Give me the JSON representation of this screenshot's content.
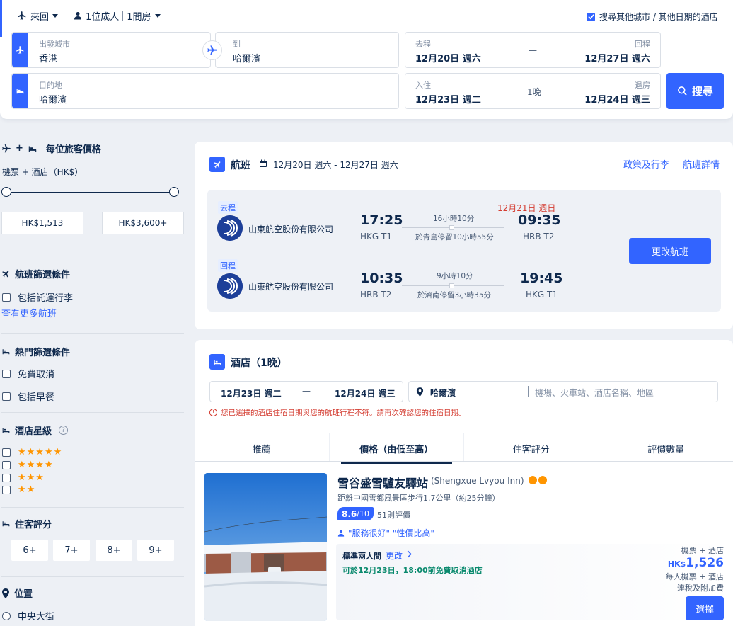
{
  "search": {
    "trip_type": "來回",
    "travellers": "1位成人",
    "rooms": "1間房",
    "other_city_option": "搜尋其他城市 / 其他日期的酒店",
    "from_label": "出發城市",
    "from_value": "香港",
    "to_label": "到",
    "to_value": "哈爾濱",
    "depart_label": "去程",
    "depart_value": "12月20日 週六",
    "return_label": "回程",
    "return_value": "12月27日 週六",
    "date_dash": "—",
    "dest_label": "目的地",
    "dest_value": "哈爾濱",
    "checkin_label": "入住",
    "checkin_value": "12月23日 週二",
    "nights": "1晚",
    "checkout_label": "退房",
    "checkout_value": "12月24日 週三",
    "search_button": "搜尋"
  },
  "sidebar": {
    "price_title": "每位旅客價格",
    "price_subtitle": "機票 + 酒店（HK$）",
    "plus": "+",
    "price_min": "HK$1,513",
    "price_dash": "-",
    "price_max": "HK$3,600+",
    "flight_filter_title": "航班篩選條件",
    "flight_filter_option": "包括託運行李",
    "more_flights_link": "查看更多航班",
    "popular_title": "熱門篩選條件",
    "popular_options": [
      "免費取消",
      "包括早餐"
    ],
    "star_title": "酒店星級",
    "star_levels": [
      "★★★★★",
      "★★★★",
      "★★★",
      "★★"
    ],
    "review_title": "住客評分",
    "review_options": [
      "6+",
      "7+",
      "8+",
      "9+"
    ],
    "location_title": "位置",
    "location_option": "中央大街"
  },
  "flight": {
    "title": "航班",
    "dates": "12月20日 週六 - 12月27日 週六",
    "policy_link": "政策及行李",
    "details_link": "航班詳情",
    "change_button": "更改航班",
    "outbound": {
      "tag": "去程",
      "airline": "山東航空股份有限公司",
      "dep_time": "17:25",
      "dep_airport": "HKG T1",
      "duration": "16小時10分",
      "stopover": "於青島停留10小時55分",
      "arrival_date": "12月21日 週日",
      "arr_time": "09:35",
      "arr_airport": "HRB T2"
    },
    "inbound": {
      "tag": "回程",
      "airline": "山東航空股份有限公司",
      "dep_time": "10:35",
      "dep_airport": "HRB T2",
      "duration": "9小時10分",
      "stopover": "於濟南停留3小時35分",
      "arr_time": "19:45",
      "arr_airport": "HKG T1"
    }
  },
  "hotel": {
    "title": "酒店（1晚）",
    "checkin": "12月23日 週二",
    "dash": "—",
    "checkout": "12月24日 週三",
    "city": "哈爾濱",
    "search_placeholder": "機場、火車站、酒店名稱、地區",
    "warning": "您已選擇的酒店住宿日期與您的航班行程不符。請再次確認您的住宿日期。",
    "tabs": [
      "推薦",
      "價格（由低至高）",
      "住客評分",
      "評價數量"
    ],
    "listing": {
      "name": "雪谷盛雪驢友驛站",
      "name_en": "(Shengxue Lvyou Inn)",
      "distance": "距離中國雪鄉風景區步行1.7公里（約25分鐘）",
      "score": "8.6",
      "score_max": "/10",
      "reviews": "51則評價",
      "highlights": "\"服務很好\" \"性價比高\"",
      "room_type": "標準兩人間",
      "change_link": "更改",
      "cancel_policy": "可於12月23日，18:00前免費取消酒店",
      "price_label": "機票 + 酒店",
      "currency": "HK$",
      "price": "1,526",
      "price_note1": "每人機票 + 酒店",
      "price_note2": "連稅及附加費",
      "select_button": "選擇"
    }
  },
  "colors": {
    "brand": "#3264ff",
    "warning": "#d43d32",
    "star": "#ff9500",
    "green": "#0b8a6e"
  }
}
